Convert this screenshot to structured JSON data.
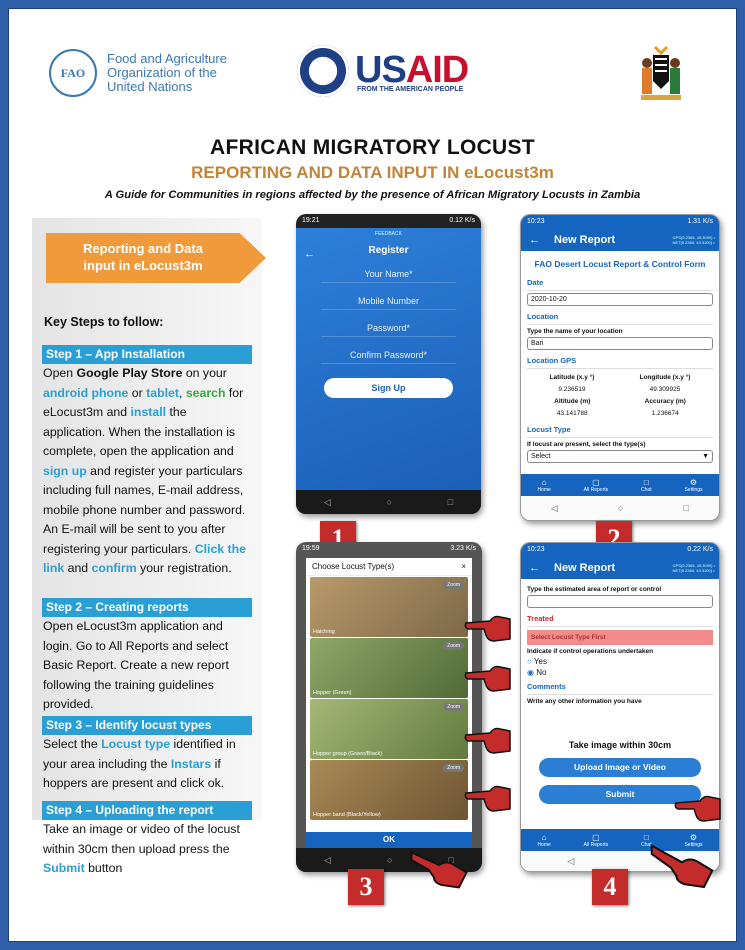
{
  "logos": {
    "fao": {
      "emblem": "FAO",
      "line1": "Food and Agriculture",
      "line2": "Organization of the",
      "line3": "United Nations"
    },
    "usaid": {
      "word_us": "US",
      "word_aid": "AID",
      "tagline": "FROM THE AMERICAN PEOPLE"
    }
  },
  "header": {
    "title": "AFRICAN MIGRATORY LOCUST",
    "subtitle": "REPORTING AND DATA INPUT IN eLocust3m",
    "guide": "A Guide for Communities in regions affected by the presence of African Migratory Locusts in Zambia"
  },
  "sidebar": {
    "banner": "Reporting and Data input in eLocust3m",
    "key_steps": "Key Steps to follow:",
    "steps": [
      {
        "header": "Step 1 – App Installation"
      },
      {
        "header": "Step 2 – Creating reports",
        "body": "Open eLocust3m application and login. Go to All Reports and select Basic Report. Create a new report following the training guidelines provided."
      },
      {
        "header": "Step 3 – Identify locust types"
      },
      {
        "header": "Step 4 – Uploading the report"
      }
    ],
    "step1_parts": [
      "Open ",
      "Google Play Store",
      " on your ",
      "android phone",
      " or ",
      "tablet",
      ", ",
      "search",
      " for eLocust3m and ",
      "install",
      " the application. When the installation is complete, open the application and ",
      "sign up",
      " and register your particulars including full names, E-mail address, mobile phone number and password. An E-mail will be sent to you after registering your particulars. ",
      "Click the link",
      " and ",
      "confirm",
      " your registration."
    ],
    "step3_parts": [
      "Select the ",
      "Locust type",
      " identified in your area including the ",
      "Instars",
      " if hoppers are present and click ok."
    ],
    "step4_parts": [
      "Take an image or video of the locust within 30cm then upload press the ",
      "Submit",
      " button"
    ]
  },
  "screen1": {
    "status_left": "19:21",
    "status_right": "0.12 K/s",
    "top_label": "FEEDBACK",
    "title": "Register",
    "fields": [
      "Your Name*",
      "Mobile Number",
      "Password*",
      "Confirm Password*"
    ],
    "button": "Sign Up",
    "number": "1"
  },
  "screen2": {
    "status_left": "10:23",
    "status_right": "1.31 K/s",
    "appbar_title": "New Report",
    "gps_line1": "GPS(9.2365, 49.3099) •",
    "gps_line2": "NET(9.2365, 49.3100) •",
    "form_title": "FAO Desert Locust Report & Control Form",
    "date_label": "Date",
    "date_value": "2020-10-20",
    "location_label": "Location",
    "location_prompt": "Type the name of your location",
    "location_value": "Bari",
    "gps_label": "Location GPS",
    "lat_label": "Latitude (x.y °)",
    "lat_value": "9.236519",
    "lon_label": "Longitude (x.y °)",
    "lon_value": "49.309925",
    "alt_label": "Altitude (m)",
    "alt_value": "43.141788",
    "acc_label": "Accuracy (m)",
    "acc_value": "1.236674",
    "locust_label": "Locust Type",
    "locust_prompt": "If locust are present, select the type(s)",
    "select_value": "Select",
    "tabs": [
      "Home",
      "All Reports",
      "Chat",
      "Settings"
    ],
    "number": "2"
  },
  "screen3": {
    "status_left": "19:59",
    "status_right": "3.23 K/s",
    "modal_title": "Choose Locust Type(s)",
    "close": "×",
    "zoom": "Zoom",
    "options": [
      "Hatching",
      "Hopper (Green)",
      "Hopper group (Green/Black)",
      "Hopper band (Black/Yellow)"
    ],
    "ok": "OK",
    "number": "3"
  },
  "screen4": {
    "status_left": "10:23",
    "status_right": "0.22 K/s",
    "appbar_title": "New Report",
    "gps_line1": "GPS(9.2365, 49.3099) •",
    "gps_line2": "NET(9.2365, 49.3100) •",
    "area_prompt": "Type the estimated area of report or control",
    "treated_label": "Treated",
    "treated_msg": "Select Locust Type First",
    "control_prompt": "Indicate if control operations undertaken",
    "yes": "Yes",
    "no": "No",
    "comments_label": "Comments",
    "comments_prompt": "Write any other information you have",
    "take_image": "Take image within 30cm",
    "upload": "Upload Image or Video",
    "submit": "Submit",
    "tabs": [
      "Home",
      "All Reports",
      "Chat",
      "Settings"
    ],
    "number": "4"
  },
  "colors": {
    "accent_blue": "#2a9fd6",
    "banner_orange": "#f09a3c",
    "subtitle_gold": "#c0843a",
    "app_blue": "#1565c0",
    "number_red": "#c42b2b"
  }
}
